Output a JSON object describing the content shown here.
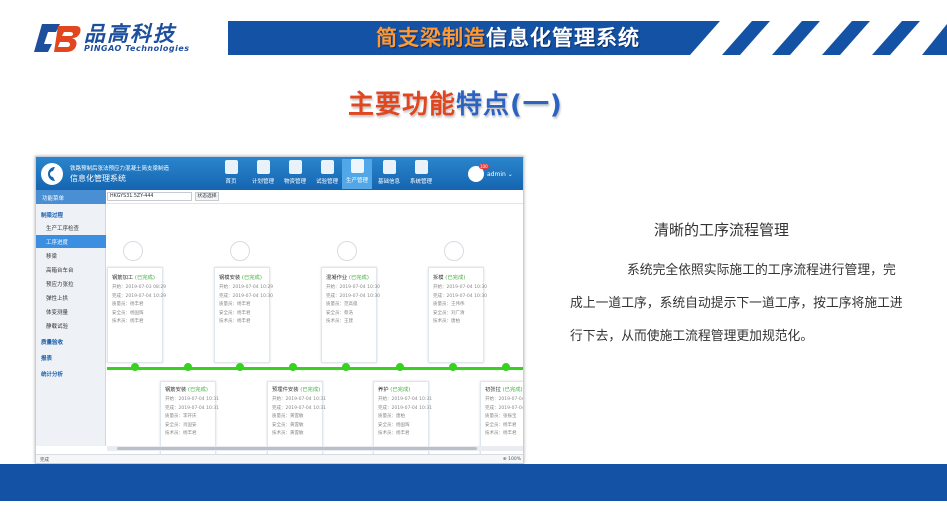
{
  "brand": {
    "name": "品高科技",
    "sub": "PINGAO Technologies"
  },
  "system_title": {
    "highlight": "简支梁制造",
    "rest": "信息化管理系统"
  },
  "page_title": {
    "part1": "主要功能",
    "part2": "特点(一)"
  },
  "app": {
    "header_line1": "铁路预制后张法预应力混凝土简支梁制造",
    "header_line2": "信息化管理系统",
    "nav": [
      {
        "label": "首页"
      },
      {
        "label": "计划管理"
      },
      {
        "label": "物资管理"
      },
      {
        "label": "试验管理"
      },
      {
        "label": "生产管理",
        "active": true
      },
      {
        "label": "基础信息"
      },
      {
        "label": "系统管理"
      }
    ],
    "badge": "100",
    "user": "admin",
    "sidebar_title": "功能菜单",
    "sidebar": [
      {
        "type": "group",
        "label": "制梁过程"
      },
      {
        "type": "item",
        "label": "生产工序检查"
      },
      {
        "type": "item",
        "label": "工序进度",
        "active": true
      },
      {
        "type": "item",
        "label": "移梁"
      },
      {
        "type": "item",
        "label": "高箱台车台"
      },
      {
        "type": "item",
        "label": "预应力张拉"
      },
      {
        "type": "item",
        "label": "弹性上拱"
      },
      {
        "type": "item",
        "label": "体变测量"
      },
      {
        "type": "item",
        "label": "静载试验"
      },
      {
        "type": "group",
        "label": "质量验收"
      },
      {
        "type": "group",
        "label": "报表"
      },
      {
        "type": "group",
        "label": "统计分析"
      }
    ],
    "search_value": "HKGYS31.5ZY-444",
    "search_button": "状态选择",
    "top_cards": [
      {
        "name": "钢筋加工",
        "status": "(已完成)",
        "start": "开始：2019-07-03 08:29",
        "end": "完成：2019-07-04 10:29",
        "l3": "质量员：杨丰君",
        "l4": "安全员：杨国辉",
        "l5": "技术员：杨丰君"
      },
      {
        "name": "钢模安装",
        "status": "(已完成)",
        "start": "开始：2019-07-04 10:29",
        "end": "完成：2019-07-04 10:30",
        "l3": "质量员：杨丰君",
        "l4": "安全员：杨丰君",
        "l5": "技术员：杨丰君"
      },
      {
        "name": "混凝作业",
        "status": "(已完成)",
        "start": "开始：2019-07-04 10:30",
        "end": "完成：2019-07-04 10:30",
        "l3": "质量员：范高俊",
        "l4": "安全员：蔡浩",
        "l5": "技术员：王建"
      },
      {
        "name": "拆模",
        "status": "(已完成)",
        "start": "开始：2019-07-04 10:30",
        "end": "完成：2019-07-04 10:30",
        "l3": "质量员：王伟伟",
        "l4": "安全员：刘广清",
        "l5": "技术员：唐柏"
      }
    ],
    "bottom_cards": [
      {
        "name": "钢筋安装",
        "status": "(已完成)",
        "start": "开始：2019-07-04 10:31",
        "end": "完成：2019-07-04 10:31",
        "l3": "质量员：李开庆",
        "l4": "安全员：肖国安",
        "l5": "技术员：杨丰君"
      },
      {
        "name": "预埋件安装",
        "status": "(已完成)",
        "start": "开始：2019-07-04 10:31",
        "end": "完成：2019-07-04 10:31",
        "l3": "质量员：黄雲敏",
        "l4": "安全员：黄雲敏",
        "l5": "技术员：黄雲敏"
      },
      {
        "name": "养护",
        "status": "(已完成)",
        "start": "开始：2019-07-04 10:31",
        "end": "完成：2019-07-04 10:31",
        "l3": "质量员：唐柏",
        "l4": "安全员：杨国辉",
        "l5": "技术员：杨丰君"
      },
      {
        "name": "初张拉",
        "status": "(已完成)",
        "start": "开始：2019-07-04 10:31",
        "end": "完成：2019-07-04 10:31",
        "l3": "质量员：张振宝",
        "l4": "安全员：杨丰君",
        "l5": "技术员：杨丰君"
      }
    ],
    "status_left": "完成",
    "status_right": "⊕ 100%"
  },
  "feature": {
    "title": "清晰的工序流程管理",
    "body": "系统完全依照实际施工的工序流程进行管理，完成上一道工序，系统自动提示下一道工序，按工序将施工进行下去，从而使施工流程管理更加规范化。"
  },
  "colors": {
    "brand_blue": "#1d4f9c",
    "title_red": "#e2461f",
    "title_blue": "#2c63c3",
    "footer": "#1452a5",
    "timeline": "#39d11f"
  }
}
